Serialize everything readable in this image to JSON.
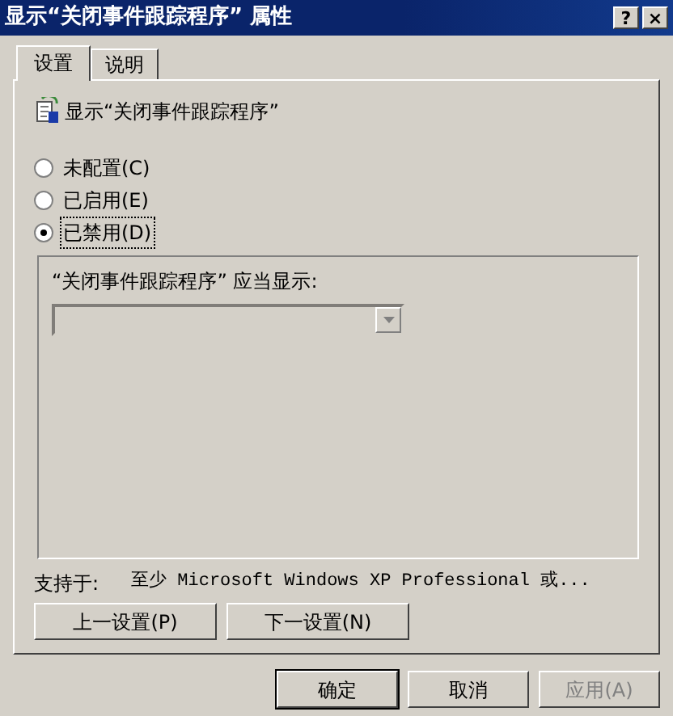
{
  "window": {
    "title": "显示“关闭事件跟踪程序” 属性",
    "help": "?",
    "close": "×"
  },
  "tabs": [
    {
      "label": "设置",
      "selected": true
    },
    {
      "label": "说明",
      "selected": false
    }
  ],
  "policy": {
    "title": "显示“关闭事件跟踪程序”"
  },
  "options": [
    {
      "label": "未配置(C)",
      "selected": false
    },
    {
      "label": "已启用(E)",
      "selected": false
    },
    {
      "label": "已禁用(D)",
      "selected": true
    }
  ],
  "group": {
    "label": "“关闭事件跟踪程序” 应当显示:",
    "combo_disabled": true
  },
  "supported": {
    "label": "支持于:",
    "value": "至少 Microsoft Windows XP Professional 或..."
  },
  "nav_buttons": [
    "上一设置(P)",
    "下一设置(N)"
  ],
  "buttons": [
    {
      "label": "确定",
      "disabled": false,
      "default": true
    },
    {
      "label": "取消",
      "disabled": false,
      "default": false
    },
    {
      "label": "应用(A)",
      "disabled": true,
      "default": false
    }
  ]
}
